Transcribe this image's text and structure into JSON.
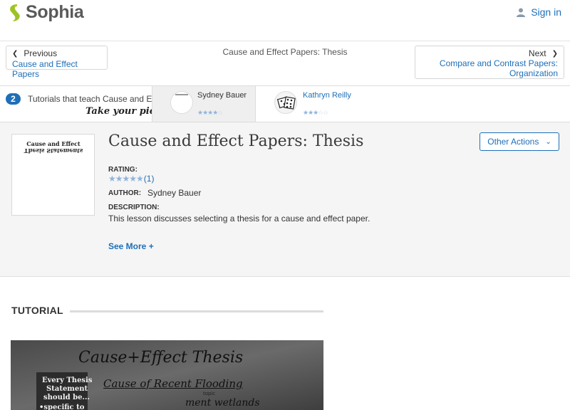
{
  "header": {
    "brand": "Sophia",
    "signin_label": "Sign in"
  },
  "nav": {
    "prev_label": "Previous",
    "prev_title": "Cause and Effect Papers",
    "current_title": "Cause and Effect Papers: Thesis",
    "next_label": "Next",
    "next_title_line1": "Compare and Contrast Papers:",
    "next_title_line2": "Organization"
  },
  "strip": {
    "count": "2",
    "teach_text": "Tutorials that teach Cause and Effect",
    "pick_text": "Take your pick:",
    "cards": [
      {
        "author": "Sydney Bauer",
        "stars": 4
      },
      {
        "author": "Kathryn Reilly",
        "stars": 3
      }
    ]
  },
  "tutorial_info": {
    "thumbnail_text_line1": "Cause and Effect",
    "thumbnail_text_line2": "Thesis Statements",
    "title": "Cause and Effect Papers: Thesis",
    "other_actions_label": "Other Actions",
    "rating_label": "RATING:",
    "rating_stars": 5,
    "rating_count": "(1)",
    "author_label": "AUTHOR:",
    "author": "Sydney Bauer",
    "description_label": "DESCRIPTION:",
    "description": "This lesson discusses selecting a thesis for a cause and effect paper.",
    "see_more_label": "See More +"
  },
  "tutorial_section": {
    "heading": "TUTORIAL"
  },
  "video": {
    "board_title": "Cause+Effect Thesis",
    "board_sub": "Cause of Recent Flooding",
    "board_small": "topic",
    "board_note": "ment wetlands",
    "card_line1": "Every Thesis",
    "card_line2": "Statement",
    "card_line3": "should be...",
    "card_line4": "•specific to"
  },
  "colors": {
    "accent": "#1d6fb8",
    "logo_green": "#b5d334",
    "info_bg": "#f5f5f5"
  }
}
